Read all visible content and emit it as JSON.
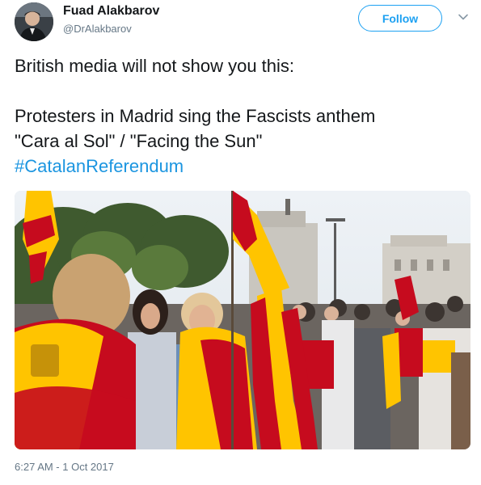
{
  "author": {
    "display_name": "Fuad Alakbarov",
    "handle": "@DrAlakbarov",
    "avatar_icon": "profile-photo"
  },
  "follow_button": {
    "label": "Follow",
    "color": "#1da1f2"
  },
  "menu_icon": "chevron-down-icon",
  "tweet": {
    "line1": "British media will not show you this:",
    "line2": "Protesters in Madrid sing the Fascists anthem",
    "line3": "\"Cara al Sol\" / \"Facing the Sun\"",
    "hashtag": "#CatalanReferendum",
    "hashtag_color": "#1b95e0"
  },
  "media": {
    "type": "photo",
    "flag_colors": {
      "red": "#c60b1e",
      "yellow": "#ffc400"
    }
  },
  "timestamp": "6:27 AM - 1 Oct 2017"
}
